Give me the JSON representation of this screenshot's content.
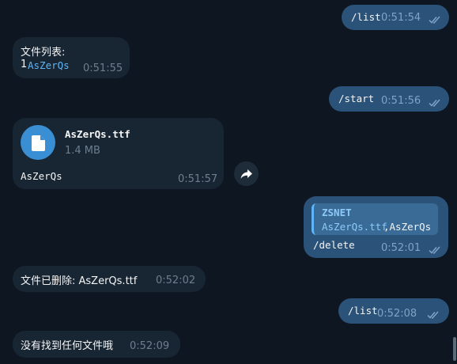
{
  "messages": {
    "m1": {
      "text": "/list",
      "time": "0:51:54"
    },
    "m2": {
      "line1": "文件列表:",
      "num": "1",
      "file": "AsZerQs",
      "time": "0:51:55"
    },
    "m3": {
      "text": "/start",
      "time": "0:51:56"
    },
    "m4": {
      "filename": "AsZerQs.ttf",
      "size": "1.4 MB",
      "caption": "AsZerQs",
      "time": "0:51:57"
    },
    "m5": {
      "reply_name": "ZSNET",
      "reply_link": "AsZerQs.ttf",
      "reply_rest": ",AsZerQs",
      "text": "/delete",
      "time": "0:52:01"
    },
    "m6": {
      "text": "文件已删除: AsZerQs.ttf",
      "time": "0:52:02"
    },
    "m7": {
      "text": "/list",
      "time": "0:52:08"
    },
    "m8": {
      "text": "没有找到任何文件哦",
      "time": "0:52:09"
    }
  },
  "icons": {
    "file": "file-icon",
    "forward": "forward-icon",
    "read": "double-check-icon"
  },
  "colors": {
    "background": "#0e1621",
    "outgoing": "#2b5278",
    "incoming": "#182533",
    "accent": "#5eb5f7"
  }
}
